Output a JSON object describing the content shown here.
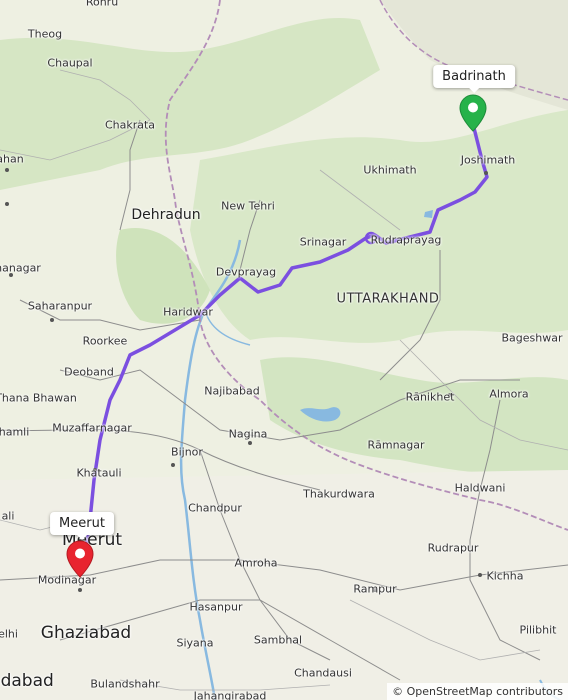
{
  "map": {
    "colors": {
      "route": "#7b4fe0",
      "start_pin": "#e8242f",
      "end_pin": "#26b24a",
      "forest": "#cfe3bb",
      "water": "#88b9e0",
      "border": "#b38db8"
    },
    "start": {
      "label": "Meerut",
      "icon": "red-map-pin-icon"
    },
    "end": {
      "label": "Badrinath",
      "icon": "green-map-pin-icon"
    },
    "region_label": "UTTARAKHAND",
    "places": {
      "rohru": "Rohru",
      "theog": "Theog",
      "chaupal": "Chaupal",
      "chakrata": "Chakrata",
      "ahan": "ahan",
      "dehradun": "Dehradun",
      "new_tehri": "New Tehri",
      "ukhimath": "Ukhimath",
      "joshimath": "Joshimath",
      "srinagar": "Srinagar",
      "rudraprayag": "Rudraprayag",
      "devprayag": "Devprayag",
      "nanagar": "nanagar",
      "saharanpur": "Saharanpur",
      "haridwar": "Haridwar",
      "roorkee": "Roorkee",
      "bageshwar": "Bageshwar",
      "deoband": "Deoband",
      "thana_bhawan": "Thana Bhawan",
      "najibabad": "Najibabad",
      "ranikhet": "Rānikhet",
      "almora": "Almora",
      "muzaffarnagar": "Muzaffarnagar",
      "hamli": "hamli",
      "nagina": "Nagina",
      "bijnor": "Bijnor",
      "ramnagar": "Rāmnagar",
      "khatauli": "Khatauli",
      "haldwani": "Haldwani",
      "thakurdwara": "Thakurdwara",
      "chandpur": "Chandpur",
      "ali": "ali",
      "meerut_town": "Meerut",
      "rudrapur": "Rudrapur",
      "amroha": "Amroha",
      "modinagar": "Modinagar",
      "rampur": "Rampur",
      "kichha": "Kichha",
      "hasanpur": "Hasanpur",
      "ghaziabad": "Ghaziabad",
      "elhi": "elhi",
      "pilibhit": "Pilibhit",
      "siyana": "Siyana",
      "sambhal": "Sambhal",
      "bulandshahr": "Bulandshahr",
      "adabad": "adabad",
      "chandausi": "Chandausi",
      "jahangirabad": "Jahangirabad"
    },
    "attribution": "© OpenStreetMap contributors"
  }
}
